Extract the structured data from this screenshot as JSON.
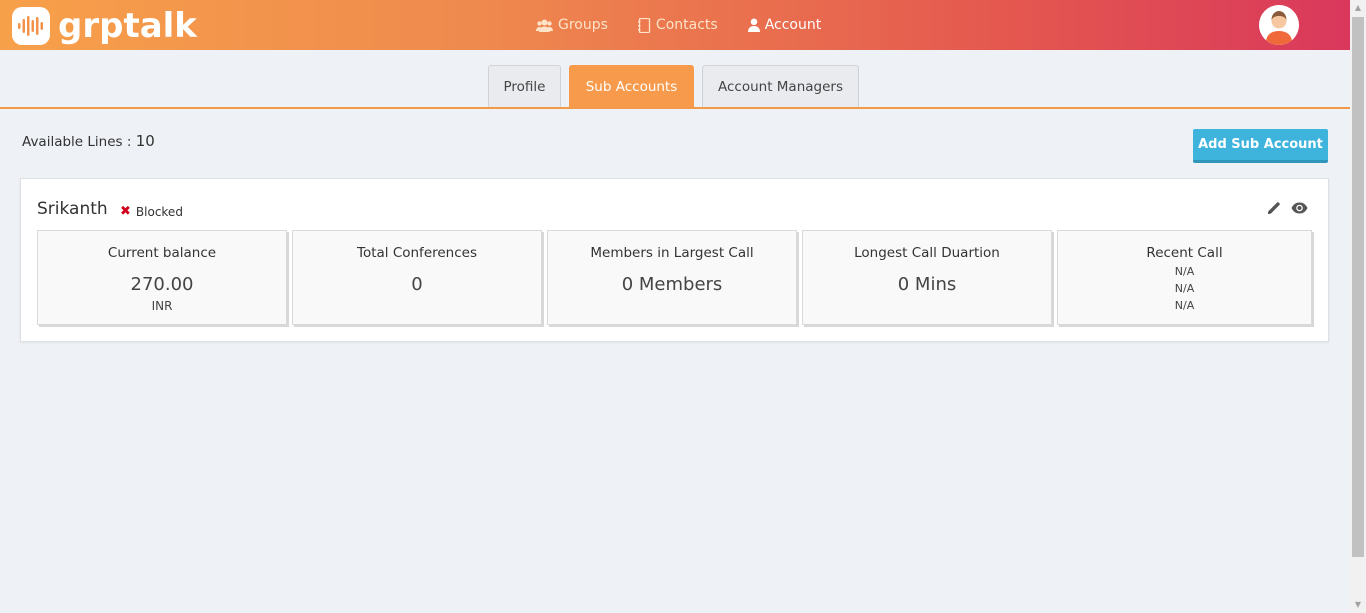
{
  "brand": {
    "name": "grptalk"
  },
  "nav": [
    {
      "label": "Groups",
      "icon": "users-icon"
    },
    {
      "label": "Contacts",
      "icon": "address-book-icon"
    },
    {
      "label": "Account",
      "icon": "user-icon"
    }
  ],
  "tabs": [
    {
      "label": "Profile"
    },
    {
      "label": "Sub Accounts"
    },
    {
      "label": "Account Managers"
    }
  ],
  "available_lines": {
    "label": "Available Lines :",
    "value": "10"
  },
  "add_button": {
    "label": "Add Sub Account"
  },
  "sub_account": {
    "name": "Srikanth",
    "status": "Blocked",
    "stats": [
      {
        "label": "Current balance",
        "value": "270.00",
        "unit": "INR"
      },
      {
        "label": "Total Conferences",
        "value": "0"
      },
      {
        "label": "Members in Largest Call",
        "value": "0 Members"
      },
      {
        "label": "Longest Call Duartion",
        "value": "0 Mins"
      }
    ],
    "recent_call": {
      "label": "Recent Call",
      "lines": [
        "N/A",
        "N/A",
        "N/A"
      ]
    }
  },
  "colors": {
    "header_start": "#f7a04a",
    "header_end": "#d9385c",
    "tab_active": "#f79a4b",
    "button": "#3eb4dd",
    "blocked": "#d0021b"
  }
}
